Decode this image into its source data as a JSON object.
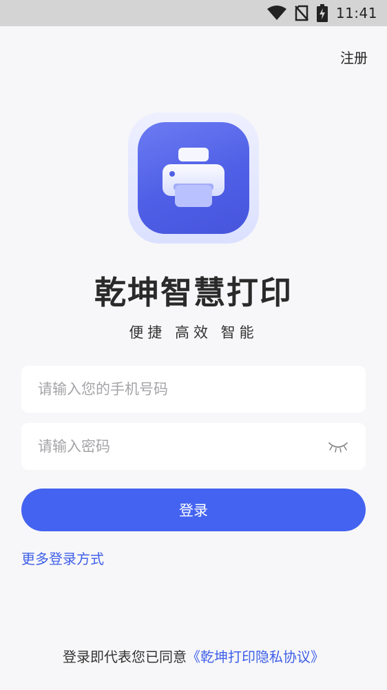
{
  "status_bar": {
    "time": "11:41",
    "icons": [
      "wifi-icon",
      "no-sim-icon",
      "battery-charging-icon"
    ]
  },
  "header": {
    "register_label": "注册"
  },
  "app": {
    "logo_icon": "printer-icon",
    "title": "乾坤智慧打印",
    "slogan": "便捷 高效 智能"
  },
  "form": {
    "phone": {
      "value": "",
      "placeholder": "请输入您的手机号码"
    },
    "password": {
      "value": "",
      "placeholder": "请输入密码",
      "toggle_icon": "eye-closed-icon"
    },
    "login_label": "登录",
    "more_login_label": "更多登录方式"
  },
  "footer": {
    "agreement_prefix": "登录即代表您已同意",
    "agreement_link": "《乾坤打印隐私协议》"
  },
  "colors": {
    "accent": "#4363f0",
    "link": "#3f5fe8",
    "background": "#f7f7f9",
    "status_bar": "#d4d4d4"
  }
}
